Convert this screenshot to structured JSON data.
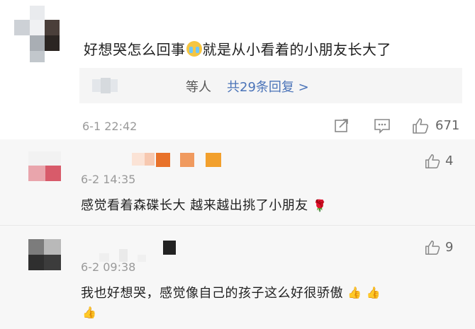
{
  "comments": [
    {
      "text_before_emoji": "好想哭怎么回事",
      "emoji": "crying-face",
      "text_after_emoji": "就是从小看着的小朋友长大了",
      "reply_summary": {
        "who": "等人",
        "link": "共29条回复 >"
      },
      "timestamp": "6-1 22:42",
      "like_count": "671"
    }
  ],
  "replies": [
    {
      "timestamp": "6-2 14:35",
      "text": "感觉看着森碟长大 越来越出挑了小朋友",
      "emoji": "rose",
      "like_count": "4"
    },
    {
      "timestamp": "6-2 09:38",
      "text": "我也好想哭，感觉像自己的孩子这么好很骄傲",
      "emoji": "thumbs-up x3",
      "like_count": "9"
    }
  ],
  "colors": {
    "link": "#4a73b8",
    "timestamp": "#9a9a9a",
    "reply_bg": "#f5f5f5",
    "sub_bg": "#f7f7f7"
  }
}
